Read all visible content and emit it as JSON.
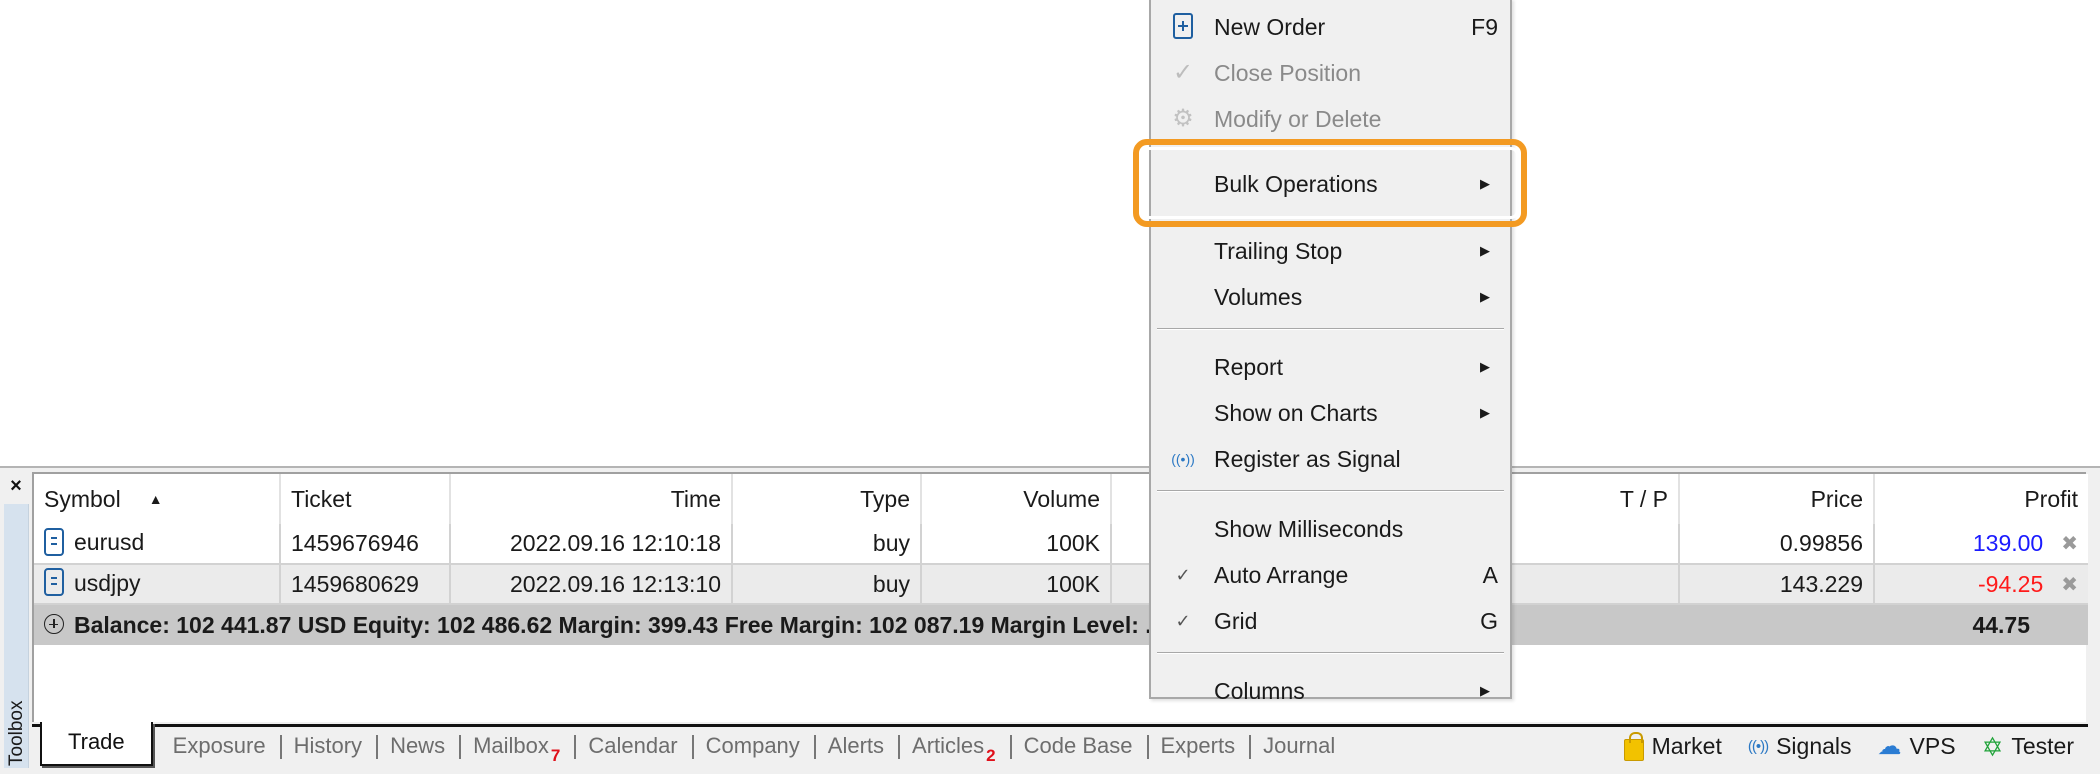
{
  "toolbox": {
    "label": "Toolbox",
    "close_label": "×"
  },
  "table": {
    "columns": [
      {
        "label": "Symbol",
        "sort": "ascending"
      },
      {
        "label": "Ticket"
      },
      {
        "label": "Time"
      },
      {
        "label": "Type"
      },
      {
        "label": "Volume"
      },
      {
        "label": "T / P"
      },
      {
        "label": "Price"
      },
      {
        "label": "Profit"
      }
    ],
    "rows": [
      {
        "symbol": "eurusd",
        "ticket": "1459676946",
        "time": "2022.09.16 12:10:18",
        "type": "buy",
        "volume": "100K",
        "tp": "",
        "price": "0.99856",
        "profit": "139.00",
        "profit_color": "#1a1aff"
      },
      {
        "symbol": "usdjpy",
        "ticket": "1459680629",
        "time": "2022.09.16 12:13:10",
        "type": "buy",
        "volume": "100K",
        "tp": "",
        "price": "143.229",
        "profit": "-94.25",
        "profit_color": "#ff1a1a"
      }
    ],
    "summary": {
      "text": "Balance: 102 441.87 USD  Equity: 102 486.62  Margin: 399.43  Free Margin: 102 087.19  Margin Level: ...",
      "total_profit": "44.75"
    }
  },
  "tabs": [
    {
      "label": "Trade",
      "active": true
    },
    {
      "label": "Exposure"
    },
    {
      "label": "History"
    },
    {
      "label": "News"
    },
    {
      "label": "Mailbox",
      "badge": "7"
    },
    {
      "label": "Calendar"
    },
    {
      "label": "Company"
    },
    {
      "label": "Alerts"
    },
    {
      "label": "Articles",
      "badge": "2"
    },
    {
      "label": "Code Base"
    },
    {
      "label": "Experts"
    },
    {
      "label": "Journal"
    }
  ],
  "right_links": [
    {
      "label": "Market",
      "icon": "shopping-bag-icon"
    },
    {
      "label": "Signals",
      "icon": "signal-icon"
    },
    {
      "label": "VPS",
      "icon": "cloud-icon"
    },
    {
      "label": "Tester",
      "icon": "tester-star-icon"
    }
  ],
  "context_menu": {
    "items": [
      {
        "label": "New Order",
        "shortcut": "F9",
        "icon": "new-order-icon",
        "enabled": true
      },
      {
        "label": "Close Position",
        "icon": "check-icon",
        "enabled": false
      },
      {
        "label": "Modify or Delete",
        "icon": "gear-icon",
        "enabled": false
      },
      {
        "label": "Bulk Operations",
        "submenu": true,
        "highlighted": true
      },
      {
        "label": "Trailing Stop",
        "submenu": true
      },
      {
        "label": "Volumes",
        "submenu": true
      },
      {
        "label": "Report",
        "submenu": true
      },
      {
        "label": "Show on Charts",
        "submenu": true
      },
      {
        "label": "Register as Signal",
        "icon": "signal-icon"
      },
      {
        "label": "Show Milliseconds"
      },
      {
        "label": "Auto Arrange",
        "shortcut": "A",
        "checked": true
      },
      {
        "label": "Grid",
        "shortcut": "G",
        "checked": true
      },
      {
        "label": "Columns",
        "submenu": true
      }
    ]
  },
  "colors": {
    "highlight": "#f39a22",
    "profit_positive": "#1a1aff",
    "profit_negative": "#ff1a1a",
    "badge": "#e0101a"
  }
}
